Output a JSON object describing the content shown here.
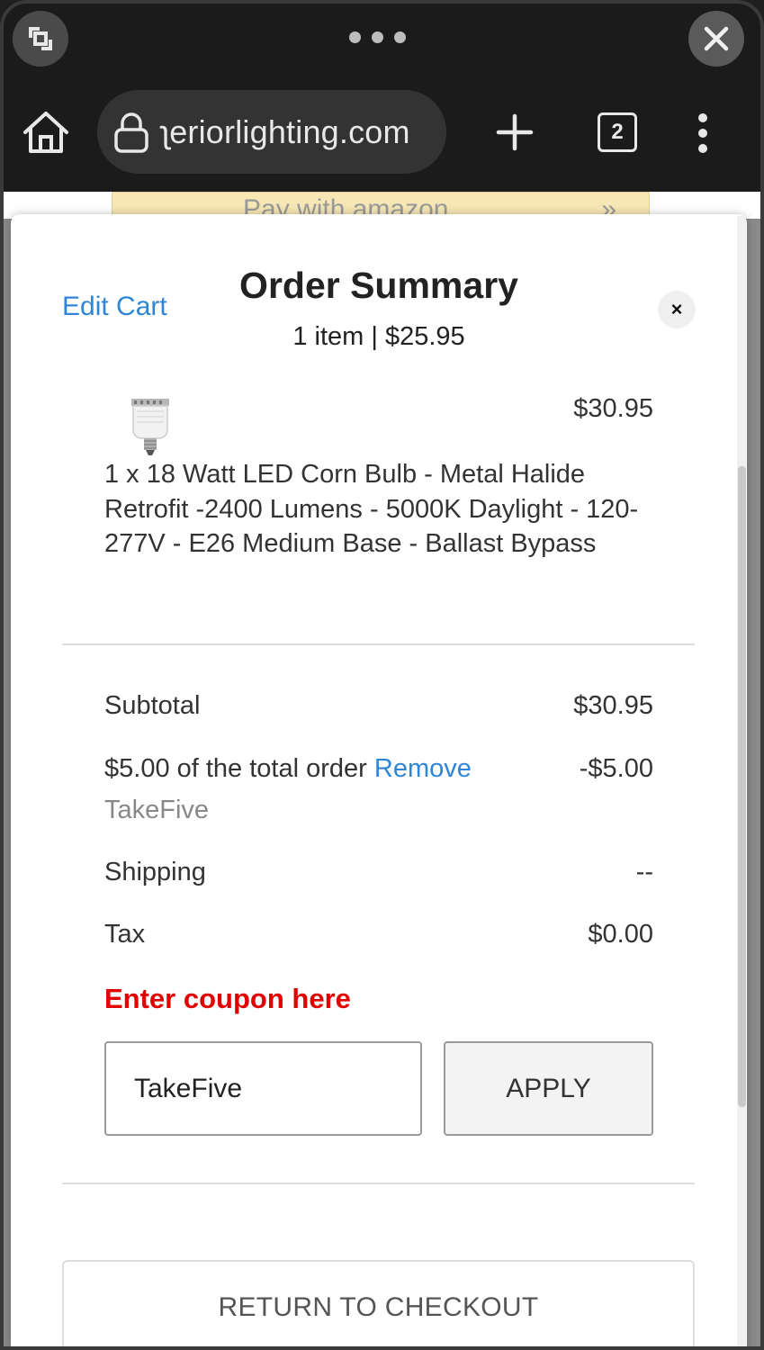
{
  "browser": {
    "url": "ʅeriorlighting.com",
    "tab_count": "2",
    "icons": {
      "minimize": "collapse-icon",
      "more": "more-horizontal-icon",
      "close": "close-icon",
      "home": "home-icon",
      "lock": "lock-icon",
      "new_tab": "plus-icon",
      "tabs": "tabs-icon",
      "menu": "more-vertical-icon"
    }
  },
  "background_page": {
    "amazon_button": "Pay with amazon",
    "amazon_arrows": "»"
  },
  "modal": {
    "edit_cart": "Edit Cart",
    "title": "Order Summary",
    "subtitle": "1 item | $25.95",
    "close": "×",
    "product": {
      "price": "$30.95",
      "description": "1 x 18 Watt LED Corn Bulb - Metal Halide Retrofit -2400 Lumens - 5000K Daylight - 120-277V - E26 Medium Base - Ballast Bypass"
    },
    "totals": {
      "subtotal_label": "Subtotal",
      "subtotal_value": "$30.95",
      "discount_label": "$5.00 of the total order",
      "discount_remove": "Remove",
      "discount_value": "-$5.00",
      "discount_code": "TakeFive",
      "shipping_label": "Shipping",
      "shipping_value": "--",
      "tax_label": "Tax",
      "tax_value": "$0.00"
    },
    "coupon": {
      "label": "Enter coupon here",
      "input_value": "TakeFive",
      "apply": "APPLY"
    },
    "return_button": "RETURN TO CHECKOUT"
  },
  "colors": {
    "link": "#2f86d6",
    "coupon_label": "#e00000",
    "chrome_bg": "#1b1b1b"
  }
}
